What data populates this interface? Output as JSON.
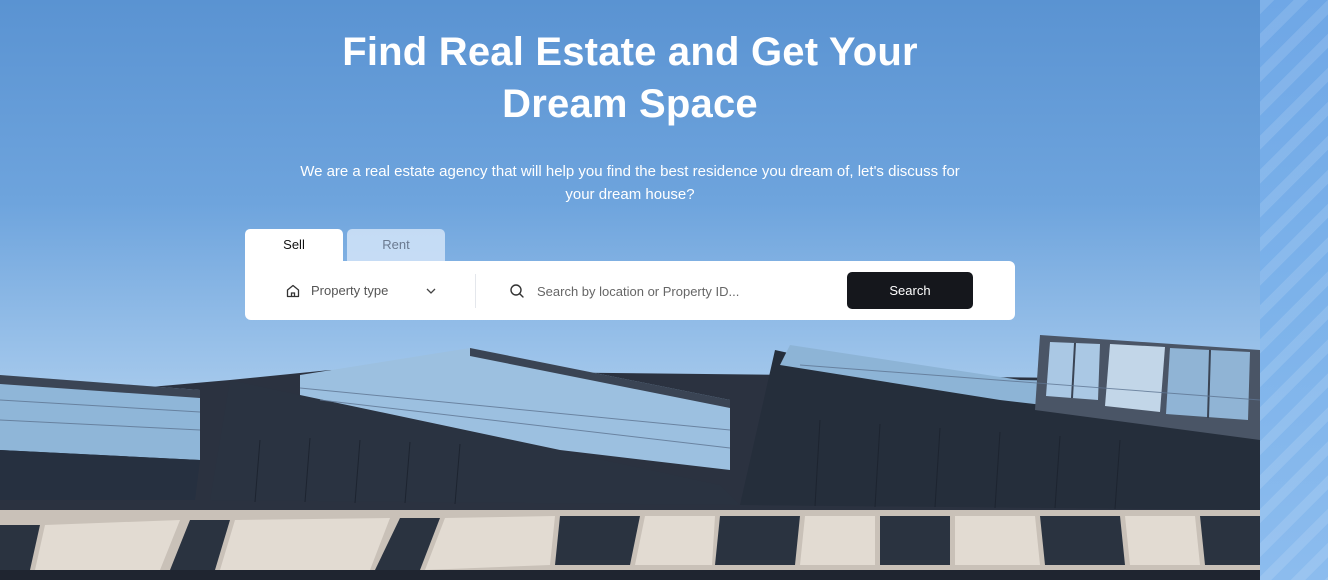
{
  "hero": {
    "headline": "Find  Real Estate and Get Your\nDream Space",
    "subtext": "We are a real estate agency that will help you find the best residence you dream of, let's discuss for your dream house?"
  },
  "tabs": [
    {
      "label": "Sell",
      "active": true
    },
    {
      "label": "Rent",
      "active": false
    }
  ],
  "search": {
    "property_type_label": "Property type",
    "placeholder": "Search by location or Property ID...",
    "button_label": "Search"
  },
  "icons": {
    "home": "home-icon",
    "chevron": "chevron-down-icon",
    "search": "search-icon"
  },
  "colors": {
    "sky_top": "#5a93d2",
    "button_bg": "#15171c",
    "tab_inactive_bg": "#d2e4f8"
  }
}
